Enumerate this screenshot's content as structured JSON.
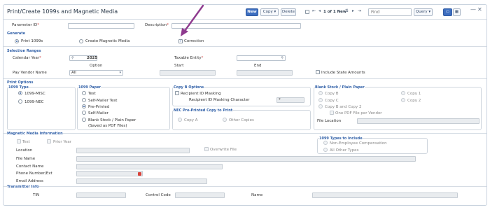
{
  "window": {
    "title": "Print/Create 1099s and Magnetic Media"
  },
  "toolbar": {
    "new_label": "New",
    "copy_label": "Copy",
    "delete_label": "Delete",
    "record_nav": "1 of 1 New",
    "find_placeholder": "Find",
    "query_label": "Query"
  },
  "header": {
    "parameter_id_label": "Parameter ID",
    "description_label": "Description",
    "parameter_id_value": "",
    "description_value": ""
  },
  "generate": {
    "section_title": "Generate",
    "print_1099s_label": "Print 1099s",
    "create_magnetic_media_label": "Create Magnetic Media",
    "correction_label": "Correction",
    "selected": "print_1099s",
    "correction_checked": true
  },
  "selection_ranges": {
    "section_title": "Selection Ranges",
    "calendar_year_label": "Calendar Year",
    "calendar_year_value": "2025",
    "taxable_entity_label": "Taxable Entity",
    "option_header": "Option",
    "start_header": "Start",
    "end_header": "End",
    "pay_vendor_name_label": "Pay Vendor Name",
    "pay_vendor_option": "All",
    "include_state_amounts_label": "Include State Amounts"
  },
  "print_options": {
    "section_title": "Print Options",
    "type_group": {
      "title": "1099 Type",
      "misc_label": "1099-MISC",
      "nec_label": "1099-NEC",
      "selected": "misc"
    },
    "paper_group": {
      "title": "1099 Paper",
      "options": [
        "Test",
        "Self-Mailer Test",
        "Pre-Printed",
        "Self-Mailer",
        "Blank Stock / Plain Paper"
      ],
      "blank_stock_note": "(Saved as PDF Files)",
      "selected": "Pre-Printed"
    },
    "copy_b_group": {
      "title": "Copy B Options",
      "recipient_masking_label": "Recipient ID Masking",
      "masking_character_label": "Recipient ID Masking Character",
      "masking_character_value": "*"
    },
    "nec_preprinted_group": {
      "title": "NEC Pre-Printed Copy to Print",
      "copy_a_label": "Copy A",
      "other_copies_label": "Other Copies"
    },
    "blank_stock_group": {
      "title": "Blank Stock / Plain Paper",
      "copy_b_label": "Copy B",
      "copy_1_label": "Copy 1",
      "copy_c_label": "Copy C",
      "copy_2_label": "Copy 2",
      "copy_b_and_2_label": "Copy B and Copy 2",
      "one_pdf_label": "One PDF File per Vendor",
      "file_location_label": "File Location"
    }
  },
  "magnetic_media": {
    "section_title": "Magnetic Media Information",
    "test_label": "Test",
    "prior_year_label": "Prior Year",
    "location_label": "Location",
    "overwrite_file_label": "Overwrite File",
    "file_name_label": "File Name",
    "contact_name_label": "Contact Name",
    "phone_label": "Phone Number/Ext",
    "email_label": "Email Address",
    "types_group": {
      "title": "1099 Types to Include",
      "non_employee_label": "Non-Employee Compensation",
      "all_other_label": "All Other Types"
    }
  },
  "transmitter": {
    "section_title": "Transmitter Info",
    "tin_label": "TIN",
    "control_code_label": "Control Code",
    "name_label": "Name"
  },
  "colors": {
    "accent": "#3e6fc0",
    "section_title": "#3261a8",
    "annotation_arrow": "#8e3a8e"
  }
}
